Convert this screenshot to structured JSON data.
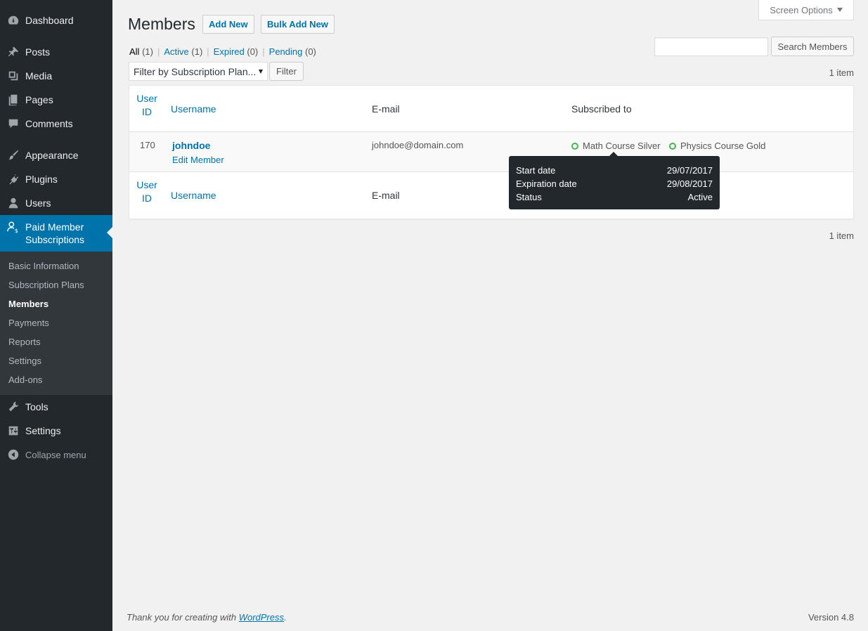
{
  "sidebar": {
    "items": [
      {
        "label": "Dashboard",
        "icon": "dashboard-icon"
      },
      {
        "label": "Posts",
        "icon": "pin-icon"
      },
      {
        "label": "Media",
        "icon": "media-icon"
      },
      {
        "label": "Pages",
        "icon": "pages-icon"
      },
      {
        "label": "Comments",
        "icon": "comment-icon"
      },
      {
        "label": "Appearance",
        "icon": "brush-icon"
      },
      {
        "label": "Plugins",
        "icon": "plugin-icon"
      },
      {
        "label": "Users",
        "icon": "user-icon"
      },
      {
        "label": "Paid Member Subscriptions",
        "icon": "member-dollar-icon"
      },
      {
        "label": "Tools",
        "icon": "wrench-icon"
      },
      {
        "label": "Settings",
        "icon": "settings-sliders-icon"
      }
    ],
    "submenu": [
      "Basic Information",
      "Subscription Plans",
      "Members",
      "Payments",
      "Reports",
      "Settings",
      "Add-ons"
    ],
    "submenu_current": "Members",
    "collapse_label": "Collapse menu"
  },
  "header": {
    "title": "Members",
    "add_new": "Add New",
    "bulk_add_new": "Bulk Add New",
    "screen_options": "Screen Options"
  },
  "views": {
    "all": {
      "label": "All",
      "count": "(1)"
    },
    "active": {
      "label": "Active",
      "count": "(1)"
    },
    "expired": {
      "label": "Expired",
      "count": "(0)"
    },
    "pending": {
      "label": "Pending",
      "count": "(0)"
    },
    "separator": "|"
  },
  "search": {
    "value": "",
    "button": "Search Members"
  },
  "filter": {
    "select_value": "Filter by Subscription Plan...",
    "button": "Filter"
  },
  "items_count": "1 item",
  "table": {
    "columns": {
      "user_id_line1": "User",
      "user_id_line2": "ID",
      "username": "Username",
      "email": "E-mail",
      "subscribed_to": "Subscribed to"
    },
    "rows": [
      {
        "user_id": "170",
        "username": "johndoe",
        "edit_action": "Edit Member",
        "email": "johndoe@domain.com",
        "subscriptions": [
          "Math Course Silver",
          "Physics Course Gold"
        ]
      }
    ]
  },
  "tooltip": {
    "start_label": "Start date",
    "start_value": "29/07/2017",
    "expiration_label": "Expiration date",
    "expiration_value": "29/08/2017",
    "status_label": "Status",
    "status_value": "Active"
  },
  "footer": {
    "thanks_prefix": "Thank you for creating with ",
    "thanks_link": "WordPress",
    "thanks_suffix": ".",
    "version": "Version 4.8"
  },
  "colors": {
    "accent": "#0073aa",
    "sidebar": "#23282d",
    "active_status": "#46b450"
  }
}
